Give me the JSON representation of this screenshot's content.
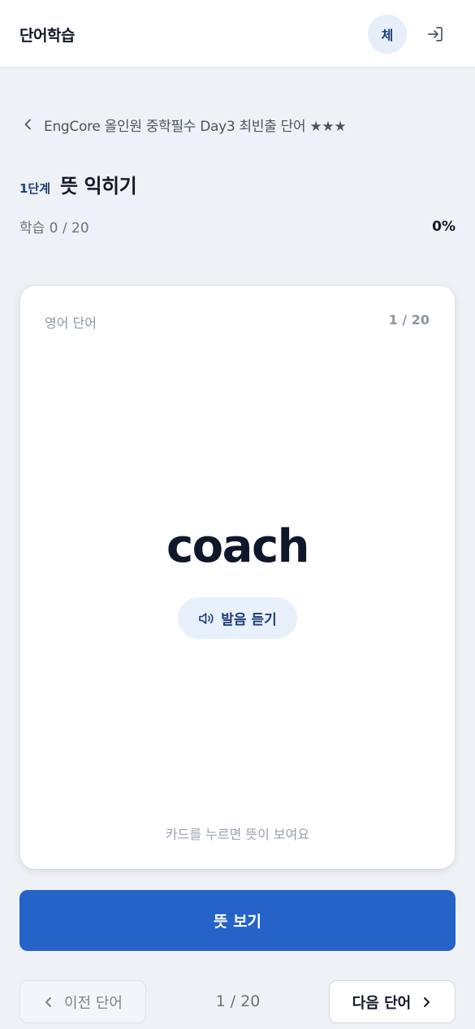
{
  "header": {
    "title": "단어학습",
    "avatar_initial": "체",
    "logout_icon": "logout-icon"
  },
  "breadcrumb": {
    "back_icon": "chevron-left-icon",
    "text": "EngCore 올인원 중학필수 Day3 최빈출 단어 ★★★"
  },
  "stage": {
    "label": "1단계",
    "title": "뜻 익히기"
  },
  "progress": {
    "text": "학습 0 / 20",
    "percent_text": "0%",
    "learned": 0,
    "total": 20
  },
  "card": {
    "label": "영어 단어",
    "counter": "1 / 20",
    "word": "coach",
    "listen_label": "발음 듣기",
    "listen_icon": "speaker-icon",
    "hint": "카드를 누르면 뜻이 보여요"
  },
  "actions": {
    "show_meaning": "뜻 보기",
    "prev_label": "이전 단어",
    "next_label": "다음 단어",
    "page_indicator": "1 / 20"
  },
  "colors": {
    "primary": "#2563c9",
    "accent_dark": "#1f3f78",
    "background": "#eef1f5"
  }
}
